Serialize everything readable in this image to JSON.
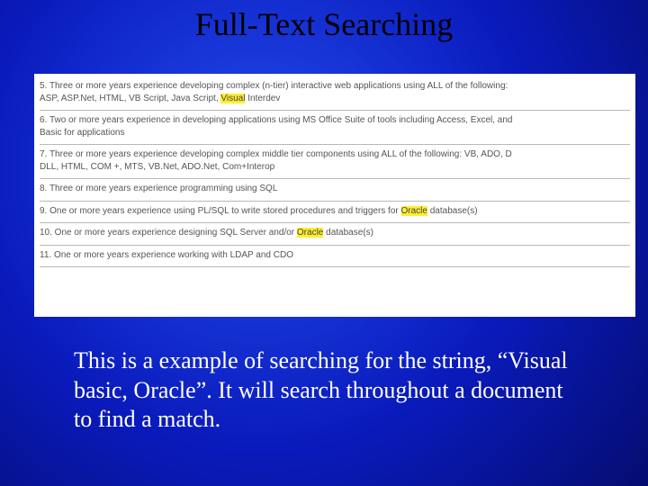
{
  "title": "Full-Text Searching",
  "highlights": {
    "visual": "Visual",
    "oracle": "Oracle"
  },
  "items": [
    {
      "pre": "5. Three or more years experience developing complex (n-tier) interactive web applications using ALL of the following: ",
      "line2_pre": "ASP, ASP.Net, HTML, VB Script, Java Script, ",
      "hl_key": "visual",
      "line2_post": " Interdev"
    },
    {
      "pre": "6. Two or more years experience in developing applications using MS Office Suite of tools including Access, Excel, and ",
      "line2_pre": "Basic for applications",
      "hl_key": null,
      "line2_post": ""
    },
    {
      "pre": "7. Three or more years experience developing complex middle tier components using ALL of the following: VB, ADO, D",
      "line2_pre": "DLL, HTML, COM +, MTS, VB.Net, ADO.Net, Com+Interop",
      "hl_key": null,
      "line2_post": ""
    },
    {
      "pre": "8. Three or more years experience programming using SQL",
      "line2_pre": null,
      "hl_key": null,
      "line2_post": ""
    },
    {
      "pre": "9. One or more years experience using PL/SQL to write stored procedures and triggers for ",
      "inline_hl_key": "oracle",
      "post": " database(s)"
    },
    {
      "pre": "10. One or more years experience designing SQL Server and/or ",
      "inline_hl_key": "oracle",
      "post": " database(s)"
    },
    {
      "pre": "11. One or more years experience working with LDAP and CDO",
      "line2_pre": null,
      "hl_key": null,
      "line2_post": ""
    }
  ],
  "caption": "This is a example of searching for the string, “Visual basic, Oracle”. It will search throughout a document to find a match."
}
